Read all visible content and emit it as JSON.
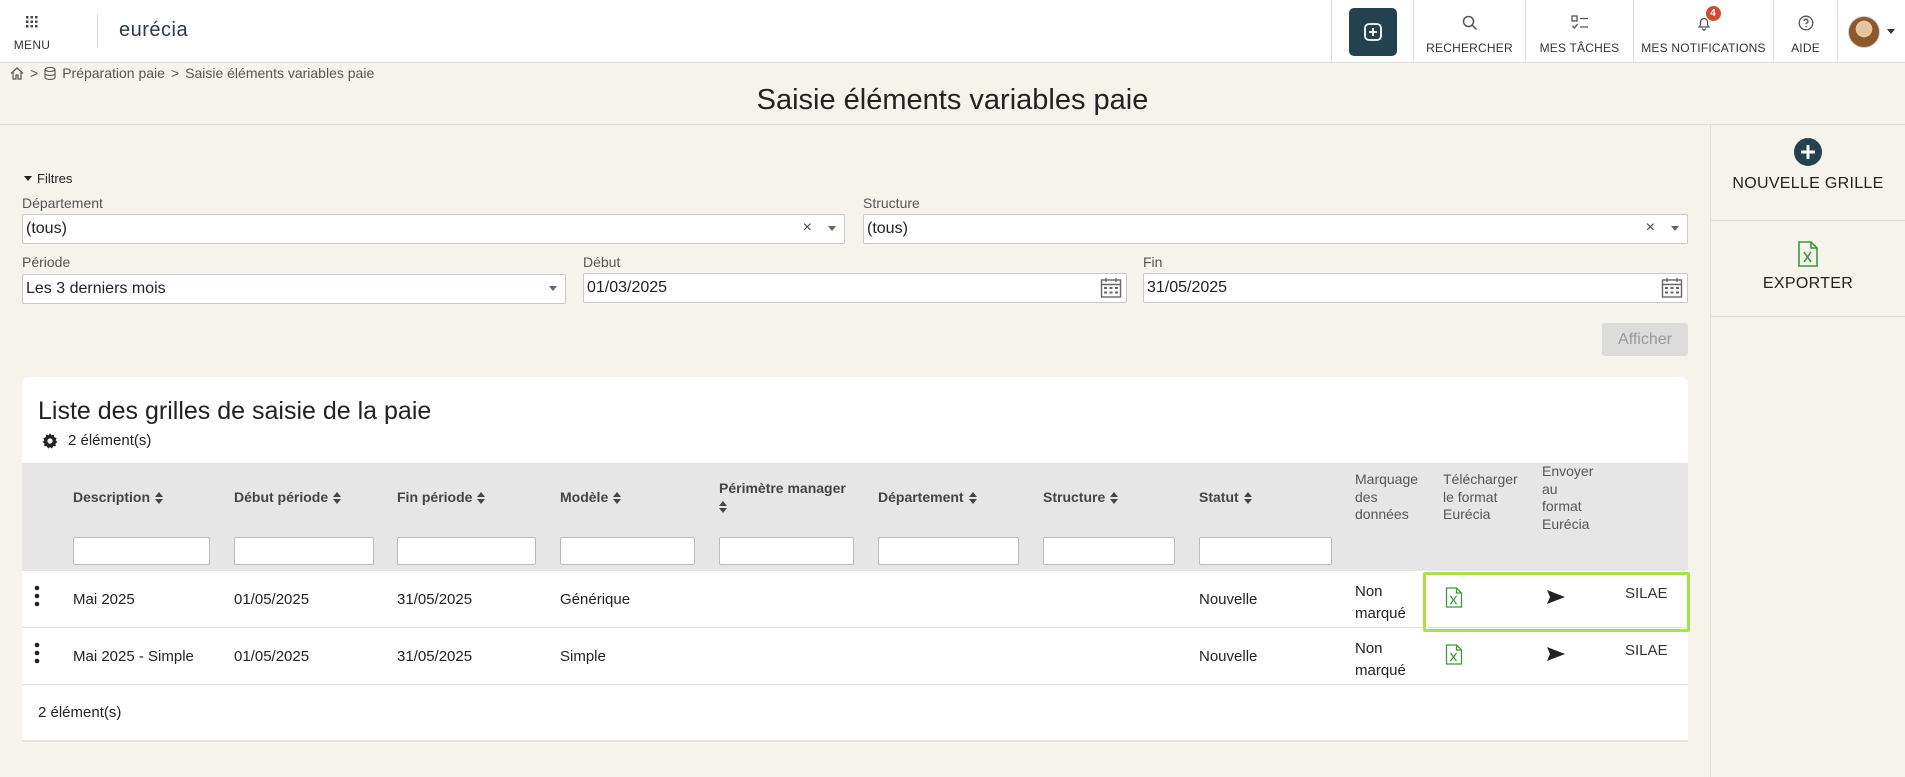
{
  "topbar": {
    "menu_label": "MENU",
    "logo": "eurécia",
    "search_label": "RECHERCHER",
    "tasks_label": "MES TÂCHES",
    "notifications_label": "MES NOTIFICATIONS",
    "notifications_count": "4",
    "help_label": "AIDE"
  },
  "breadcrumb": {
    "sep1": ">",
    "item1": "Préparation paie",
    "sep2": ">",
    "item2": "Saisie éléments variables paie"
  },
  "page": {
    "title": "Saisie éléments variables paie"
  },
  "side_actions": {
    "new_grid": "NOUVELLE GRILLE",
    "export": "EXPORTER"
  },
  "filters": {
    "toggle_label": "Filtres",
    "departement": {
      "label": "Département",
      "value": "(tous)"
    },
    "structure": {
      "label": "Structure",
      "value": "(tous)"
    },
    "periode": {
      "label": "Période",
      "value": "Les 3 derniers mois"
    },
    "debut": {
      "label": "Début",
      "value": "01/03/2025"
    },
    "fin": {
      "label": "Fin",
      "value": "31/05/2025"
    },
    "submit_label": "Afficher",
    "clear_glyph": "×"
  },
  "list": {
    "title": "Liste des grilles de saisie de la paie",
    "count": "2 élément(s)",
    "footer_count": "2 élément(s)",
    "columns": {
      "description": "Description",
      "debut": "Début période",
      "fin": "Fin période",
      "modele": "Modèle",
      "perimetre": "Périmètre manager",
      "departement": "Département",
      "structure": "Structure",
      "statut": "Statut",
      "marquage": [
        "Marquage",
        "des",
        "données"
      ],
      "telecharger": [
        "Télécharger",
        "le format",
        "Eurécia"
      ],
      "envoyer": [
        "Envoyer",
        "au",
        "format",
        "Eurécia"
      ]
    },
    "rows": [
      {
        "description": "Mai 2025",
        "debut": "01/05/2025",
        "fin": "31/05/2025",
        "modele": "Générique",
        "statut": "Nouvelle",
        "marquage": [
          "Non",
          "marqué"
        ],
        "silae": "SILAE"
      },
      {
        "description": "Mai 2025 - Simple",
        "debut": "01/05/2025",
        "fin": "31/05/2025",
        "modele": "Simple",
        "statut": "Nouvelle",
        "marquage": [
          "Non",
          "marqué"
        ],
        "silae": "SILAE"
      }
    ]
  },
  "colors": {
    "accent_dark": "#23414e",
    "excel_green": "#3a9a3a",
    "highlight": "#a5e34a",
    "badge": "#d14a33"
  }
}
